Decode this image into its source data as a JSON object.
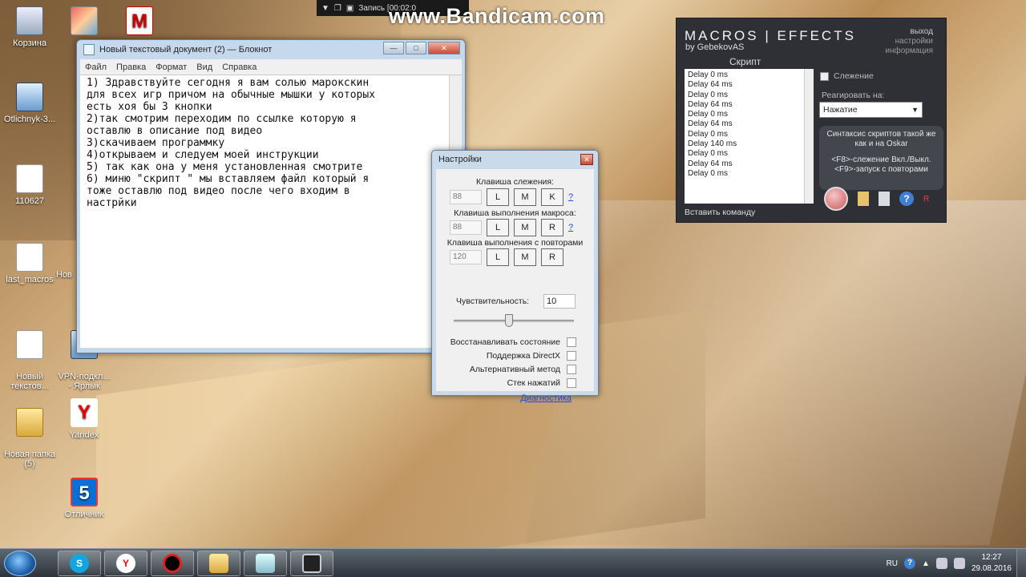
{
  "desktop_icons": [
    {
      "label": "Корзина",
      "icon": "recycle-bin-icon"
    },
    {
      "label": "",
      "icon": "picture-icon"
    },
    {
      "label": "",
      "icon": "mcafee-icon"
    },
    {
      "label": "Otlichnyk-3...",
      "icon": "app-icon"
    },
    {
      "label": "110627",
      "icon": "document-icon"
    },
    {
      "label": "last_macros",
      "icon": "document-icon"
    },
    {
      "label": "Нов",
      "icon": "document-icon"
    },
    {
      "label": "Новый\nтекстов...",
      "icon": "document-icon"
    },
    {
      "label": "VPN-подкл...\n- Ярлык",
      "icon": "vpn-icon"
    },
    {
      "label": "Новая папка\n(5)",
      "icon": "folder-icon"
    },
    {
      "label": "Yandex",
      "icon": "yandex-icon"
    },
    {
      "label": "Отличник",
      "icon": "otlichnik-icon"
    }
  ],
  "bandicam": {
    "record_label": "Запись [00:02:0",
    "watermark": "www.Bandicam.com"
  },
  "notepad": {
    "title": "Новый текстовый документ (2) — Блокнот",
    "menu": [
      "Файл",
      "Правка",
      "Формат",
      "Вид",
      "Справка"
    ],
    "text": "1) Здравствуйте сегодня я вам солью марокскин\nдля всех игр причом на обычные мышки у которых\nесть хоя бы 3 кнопки\n2)так смотрим переходим по ссылке которую я\nоставлю в описание под видео\n3)скачиваем программку\n4)открываем и следуем моей инструкции\n5) так как она у меня установленная смотрите\n6) миню \"скрипт \" мы вставляем файл который я\nтоже оставлю под видео после чего входим в\nнастрйки"
  },
  "settings": {
    "title": "Настройки",
    "tracking_key_label": "Клавиша слежения:",
    "tracking_key_value": "88",
    "tracking_buttons": [
      "L",
      "M",
      "K"
    ],
    "macro_key_label": "Клавиша выполнения макроса:",
    "macro_key_value": "88",
    "macro_buttons": [
      "L",
      "M",
      "R"
    ],
    "repeat_key_label": "Клавиша выполнения с повторами",
    "repeat_key_value": "120",
    "repeat_buttons": [
      "L",
      "M",
      "R"
    ],
    "help_link": "?",
    "sensitivity_label": "Чувствительность:",
    "sensitivity_value": "10",
    "options": [
      "Восстанавливать состояние",
      "Поддержка DirectX",
      "Альтернативный метод",
      "Стек нажатий"
    ],
    "diagnostics_link": "Диагностика"
  },
  "macros": {
    "brand": "MACROS | EFFECTS",
    "author": "by GebekovAS",
    "menu": [
      "выход",
      "настройки",
      "информация"
    ],
    "script_label": "Скрипт",
    "script_lines": [
      "Delay 0 ms",
      "Delay 64 ms",
      "Delay 0 ms",
      "Delay 64 ms",
      "Delay 0 ms",
      "Delay 64 ms",
      "Delay 0 ms",
      "Delay 140 ms",
      "Delay 0 ms",
      "Delay 64 ms",
      "Delay 0 ms"
    ],
    "insert_command": "Вставить команду",
    "tracking_label": "Слежение",
    "react_label": "Реагировать на:",
    "react_value": "Нажатие",
    "syntax_line1": "Синтаксис скриптов такой же",
    "syntax_line2": "как и на Oskar",
    "syntax_line3": "<F8>-слежение Вкл./Выкл.",
    "syntax_line4": "<F9>-запуск с повторами",
    "help_icon": "?",
    "rec_marker": "R"
  },
  "taskbar": {
    "language": "RU",
    "time": "12:27",
    "date": "29.08.2016"
  }
}
